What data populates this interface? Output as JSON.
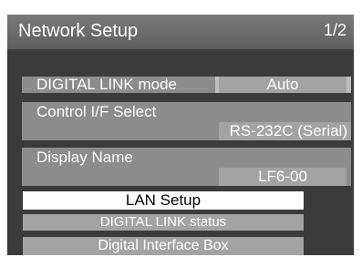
{
  "header": {
    "title": "Network Setup",
    "page": "1/2"
  },
  "settings": {
    "digital_link_mode": {
      "label": "DIGITAL LINK mode",
      "value": "Auto"
    },
    "control_if_select": {
      "label": "Control I/F Select",
      "value": "RS-232C (Serial)"
    },
    "display_name": {
      "label": "Display Name",
      "value": "LF6-00"
    }
  },
  "menu": {
    "lan_setup": "LAN Setup",
    "digital_link_status": "DIGITAL LINK  status",
    "digital_interface_box": "Digital Interface Box"
  },
  "colors": {
    "background": "#3b3b3b",
    "header": "#6e6e6e",
    "row": "#8c8c8c",
    "value": "#a3a3a3",
    "selected": "#ffffff"
  }
}
